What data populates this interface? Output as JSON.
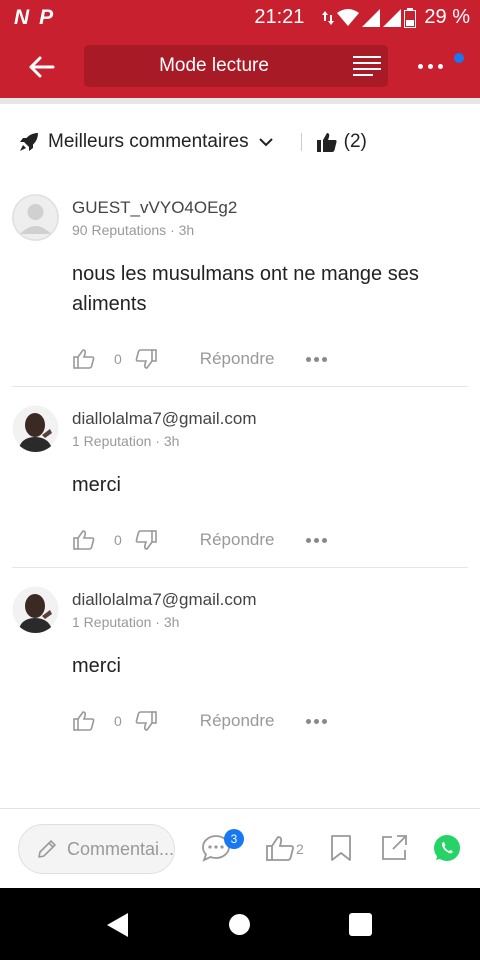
{
  "status_bar": {
    "time": "21:21",
    "battery": "29 %",
    "left_icons": [
      "N",
      "P"
    ]
  },
  "app_bar": {
    "title": "Mode lecture"
  },
  "sort": {
    "label": "Meilleurs commentaires",
    "like_count": "(2)"
  },
  "comments": [
    {
      "author": "GUEST_vVYO4OEg2",
      "meta": "90 Reputations · 3h",
      "text": "nous les musulmans ont ne mange ses aliments",
      "likes": "0",
      "reply_label": "Répondre"
    },
    {
      "author": "diallolalma7@gmail.com",
      "meta": "1 Reputation · 3h",
      "text": "merci",
      "likes": "0",
      "reply_label": "Répondre"
    },
    {
      "author": "diallolalma7@gmail.com",
      "meta": "1 Reputation · 3h",
      "text": "merci",
      "likes": "0",
      "reply_label": "Répondre"
    }
  ],
  "bottom_bar": {
    "comment_placeholder": "Commentai...",
    "comment_badge": "3",
    "like_count": "2"
  },
  "colors": {
    "brand_red": "#c8202f",
    "accent_blue": "#1877f2",
    "whatsapp_green": "#25d366"
  }
}
